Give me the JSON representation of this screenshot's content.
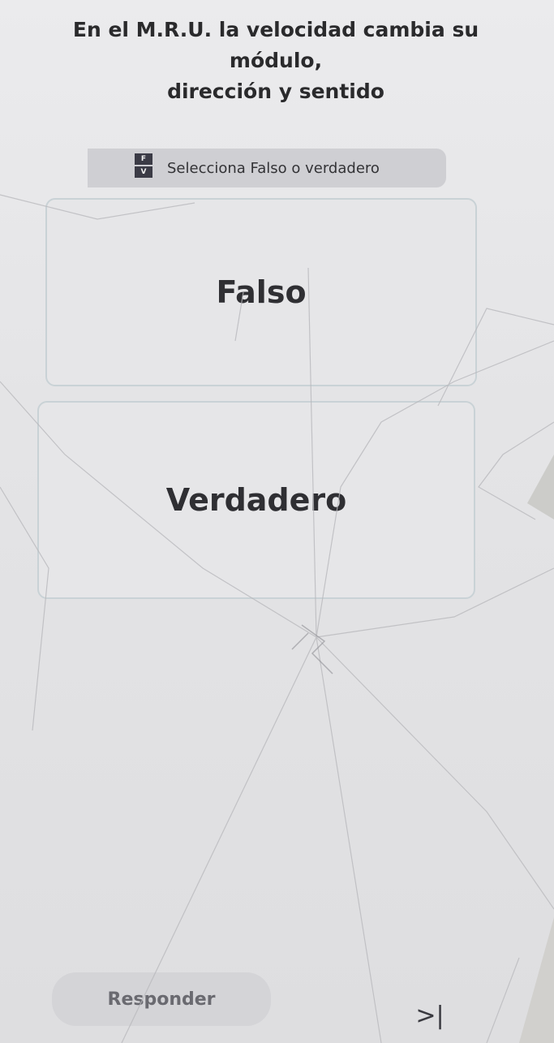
{
  "question": {
    "line1": "En el M.R.U. la velocidad cambia su módulo,",
    "line2": "dirección y sentido"
  },
  "instruction": {
    "icon": "true-false-icon",
    "icon_top": "F",
    "icon_bottom": "V",
    "text": "Selecciona Falso o verdadero"
  },
  "options": [
    {
      "label": "Falso"
    },
    {
      "label": "Verdadero"
    }
  ],
  "footer": {
    "answer_label": "Responder",
    "skip_label": ">|",
    "skip_icon": "skip-icon"
  }
}
